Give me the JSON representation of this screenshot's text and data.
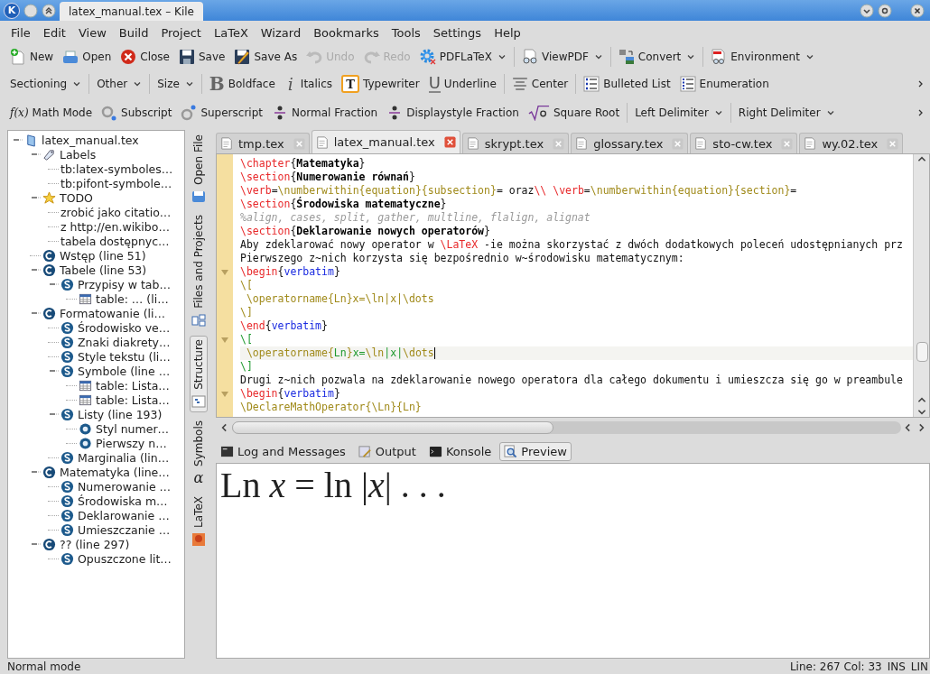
{
  "window": {
    "logo": "K",
    "title": "latex_manual.tex – Kile"
  },
  "menu": [
    "File",
    "Edit",
    "View",
    "Build",
    "Project",
    "LaTeX",
    "Wizard",
    "Bookmarks",
    "Tools",
    "Settings",
    "Help"
  ],
  "toolbars": [
    {
      "groups": [
        [
          {
            "label": "New",
            "dropdown": false,
            "disabled": false
          },
          {
            "label": "Open",
            "dropdown": false,
            "disabled": false
          },
          {
            "label": "Close",
            "dropdown": false,
            "disabled": false
          },
          {
            "label": "Save",
            "dropdown": false,
            "disabled": false
          },
          {
            "label": "Save As",
            "dropdown": false,
            "disabled": false
          },
          {
            "label": "Undo",
            "dropdown": false,
            "disabled": true
          },
          {
            "label": "Redo",
            "dropdown": false,
            "disabled": true
          },
          {
            "label": "PDFLaTeX",
            "dropdown": true,
            "disabled": false
          }
        ],
        [
          {
            "label": "ViewPDF",
            "dropdown": true,
            "disabled": false
          }
        ],
        [
          {
            "label": "Convert",
            "dropdown": true,
            "disabled": false
          }
        ],
        [
          {
            "label": "Environment",
            "dropdown": true,
            "disabled": false
          }
        ]
      ]
    },
    {
      "groups": [
        [
          {
            "label": "Sectioning",
            "dropdown": true
          }
        ],
        [
          {
            "label": "Other",
            "dropdown": true
          }
        ],
        [
          {
            "label": "Size",
            "dropdown": true
          }
        ],
        [
          {
            "label": "Boldface",
            "dropdown": false,
            "glyph": "B"
          },
          {
            "label": "Italics",
            "dropdown": false,
            "glyph": "i"
          },
          {
            "label": "Typewriter",
            "dropdown": false,
            "glyph": "T"
          },
          {
            "label": "Underline",
            "dropdown": false,
            "glyph": "U"
          }
        ],
        [
          {
            "label": "Center",
            "dropdown": false
          }
        ],
        [
          {
            "label": "Bulleted List",
            "dropdown": false
          },
          {
            "label": "Enumeration",
            "dropdown": false
          }
        ]
      ],
      "overflow": true
    },
    {
      "groups": [
        [
          {
            "label": "Math Mode",
            "dropdown": false,
            "glyph": "f(x)"
          },
          {
            "label": "Subscript",
            "dropdown": false
          },
          {
            "label": "Superscript",
            "dropdown": false
          },
          {
            "label": "Normal Fraction",
            "dropdown": false
          },
          {
            "label": "Displaystyle Fraction",
            "dropdown": false
          },
          {
            "label": "Square Root",
            "dropdown": false
          }
        ],
        [
          {
            "label": "Left Delimiter",
            "dropdown": true
          }
        ],
        [
          {
            "label": "Right Delimiter",
            "dropdown": true
          }
        ]
      ],
      "overflow": true
    }
  ],
  "structure": {
    "tree": {
      "label": "latex_manual.tex",
      "kind": "file",
      "expanded": true,
      "children": [
        {
          "label": "Labels",
          "kind": "labels",
          "expanded": true,
          "children": [
            {
              "label": "tb:latex-symboles…",
              "kind": "label"
            },
            {
              "label": "tb:pifont-symbole…",
              "kind": "label"
            }
          ]
        },
        {
          "label": "TODO",
          "kind": "todo",
          "expanded": true,
          "children": [
            {
              "label": "zrobić jako citatio…",
              "kind": "note"
            },
            {
              "label": "z http://en.wikibo…",
              "kind": "note"
            },
            {
              "label": "tabela dostępnyc…",
              "kind": "note"
            }
          ]
        },
        {
          "label": "Wstęp (line 51)",
          "kind": "chapter"
        },
        {
          "label": "Tabele (line 53)",
          "kind": "chapter",
          "expanded": true,
          "children": [
            {
              "label": "Przypisy w tab…",
              "kind": "section",
              "expanded": true,
              "children": [
                {
                  "label": "table: … (li…",
                  "kind": "table"
                }
              ]
            }
          ]
        },
        {
          "label": "Formatowanie (li…",
          "kind": "chapter",
          "expanded": true,
          "children": [
            {
              "label": "Środowisko ve…",
              "kind": "section"
            },
            {
              "label": "Znaki diakrety…",
              "kind": "section"
            },
            {
              "label": "Style tekstu (li…",
              "kind": "section"
            },
            {
              "label": "Symbole (line …",
              "kind": "section",
              "expanded": true,
              "children": [
                {
                  "label": "table: Lista…",
                  "kind": "table"
                },
                {
                  "label": "table: Lista…",
                  "kind": "table"
                }
              ]
            },
            {
              "label": "Listy (line 193)",
              "kind": "section",
              "expanded": true,
              "children": [
                {
                  "label": "Styl numer…",
                  "kind": "item"
                },
                {
                  "label": "Pierwszy n…",
                  "kind": "item"
                }
              ]
            },
            {
              "label": "Marginalia (lin…",
              "kind": "section"
            }
          ]
        },
        {
          "label": "Matematyka (line…",
          "kind": "chapter",
          "expanded": true,
          "children": [
            {
              "label": "Numerowanie …",
              "kind": "section"
            },
            {
              "label": "Środowiska m…",
              "kind": "section"
            },
            {
              "label": "Deklarowanie …",
              "kind": "section"
            },
            {
              "label": "Umieszczanie …",
              "kind": "section"
            }
          ]
        },
        {
          "label": "?? (line 297)",
          "kind": "chapter",
          "expanded": true,
          "children": [
            {
              "label": "Opuszczone lit…",
              "kind": "section"
            }
          ]
        }
      ]
    }
  },
  "side_tabs": [
    {
      "label": "Open File",
      "selected": false
    },
    {
      "label": "Files and Projects",
      "selected": false
    },
    {
      "label": "Structure",
      "selected": true
    },
    {
      "label": "Symbols",
      "selected": false,
      "glyph": "α"
    },
    {
      "label": "LaTeX",
      "selected": false
    }
  ],
  "editor": {
    "tabs": [
      {
        "label": "tmp.tex",
        "selected": false
      },
      {
        "label": "latex_manual.tex",
        "selected": true
      },
      {
        "label": "skrypt.tex",
        "selected": false
      },
      {
        "label": "glossary.tex",
        "selected": false
      },
      {
        "label": "sto-cw.tex",
        "selected": false
      },
      {
        "label": "wy.02.tex",
        "selected": false
      }
    ],
    "lines": [
      {
        "fold": false,
        "current": false,
        "segments": [
          {
            "t": "\\chapter",
            "kind": "cmd"
          },
          {
            "t": "{",
            "kind": "plain"
          },
          {
            "t": "Matematyka",
            "kind": "bold"
          },
          {
            "t": "}",
            "kind": "plain"
          }
        ]
      },
      {
        "fold": false,
        "current": false,
        "segments": [
          {
            "t": "\\section",
            "kind": "cmd"
          },
          {
            "t": "{",
            "kind": "plain"
          },
          {
            "t": "Numerowanie równań",
            "kind": "bold"
          },
          {
            "t": "}",
            "kind": "plain"
          }
        ]
      },
      {
        "fold": false,
        "current": false,
        "segments": [
          {
            "t": "\\verb",
            "kind": "cmd"
          },
          {
            "t": "=",
            "kind": "plain"
          },
          {
            "t": "\\numberwithin{equation}{subsection}",
            "kind": "math"
          },
          {
            "t": "= oraz",
            "kind": "plain"
          },
          {
            "t": "\\\\ ",
            "kind": "cmd"
          },
          {
            "t": "\\verb",
            "kind": "cmd"
          },
          {
            "t": "=",
            "kind": "plain"
          },
          {
            "t": "\\numberwithin{equation}{section}",
            "kind": "math"
          },
          {
            "t": "=",
            "kind": "plain"
          }
        ]
      },
      {
        "fold": false,
        "current": false,
        "segments": [
          {
            "t": "\\section",
            "kind": "cmd"
          },
          {
            "t": "{",
            "kind": "plain"
          },
          {
            "t": "Środowiska matematyczne",
            "kind": "bold"
          },
          {
            "t": "}",
            "kind": "plain"
          }
        ]
      },
      {
        "fold": false,
        "current": false,
        "segments": [
          {
            "t": "%align, cases, split, gather, multline, flalign, alignat",
            "kind": "comment"
          }
        ]
      },
      {
        "fold": false,
        "current": false,
        "segments": [
          {
            "t": "\\section",
            "kind": "cmd"
          },
          {
            "t": "{",
            "kind": "plain"
          },
          {
            "t": "Deklarowanie nowych operatorów",
            "kind": "bold"
          },
          {
            "t": "}",
            "kind": "plain"
          }
        ]
      },
      {
        "fold": false,
        "current": false,
        "segments": [
          {
            "t": "Aby zdeklarować nowy operator w ",
            "kind": "plain"
          },
          {
            "t": "\\LaTeX",
            "kind": "cmd"
          },
          {
            "t": " -ie można skorzystać z dwóch dodatkowych poleceń udostępnianych prz",
            "kind": "plain"
          }
        ]
      },
      {
        "fold": false,
        "current": false,
        "segments": [
          {
            "t": "Pierwszego z~nich korzysta się bezpośrednio w~środowisku matematycznym:",
            "kind": "plain"
          }
        ]
      },
      {
        "fold": true,
        "current": false,
        "segments": [
          {
            "t": "\\begin",
            "kind": "cmd"
          },
          {
            "t": "{",
            "kind": "plain"
          },
          {
            "t": "verbatim",
            "kind": "env"
          },
          {
            "t": "}",
            "kind": "plain"
          }
        ]
      },
      {
        "fold": false,
        "current": false,
        "segments": [
          {
            "t": "\\[",
            "kind": "math"
          }
        ]
      },
      {
        "fold": false,
        "current": false,
        "segments": [
          {
            "t": " \\operatorname{Ln}x=\\ln|x|\\dots",
            "kind": "math"
          }
        ]
      },
      {
        "fold": false,
        "current": false,
        "segments": [
          {
            "t": "\\]",
            "kind": "math"
          }
        ]
      },
      {
        "fold": false,
        "current": false,
        "segments": [
          {
            "t": "\\end",
            "kind": "cmd"
          },
          {
            "t": "{",
            "kind": "plain"
          },
          {
            "t": "verbatim",
            "kind": "env"
          },
          {
            "t": "}",
            "kind": "plain"
          }
        ]
      },
      {
        "fold": true,
        "current": false,
        "segments": [
          {
            "t": "\\[",
            "kind": "green"
          }
        ]
      },
      {
        "fold": false,
        "current": true,
        "segments": [
          {
            "t": " \\operatorname{",
            "kind": "math"
          },
          {
            "t": "Ln",
            "kind": "green"
          },
          {
            "t": "}",
            "kind": "math"
          },
          {
            "t": "x=",
            "kind": "green"
          },
          {
            "t": "\\ln",
            "kind": "math"
          },
          {
            "t": "|x|",
            "kind": "green"
          },
          {
            "t": "\\dots",
            "kind": "math"
          }
        ]
      },
      {
        "fold": false,
        "current": false,
        "segments": [
          {
            "t": "\\]",
            "kind": "green"
          }
        ]
      },
      {
        "fold": false,
        "current": false,
        "segments": [
          {
            "t": "Drugi z~nich pozwala na zdeklarowanie nowego operatora dla całego dokumentu i umieszcza się go w preambule",
            "kind": "plain"
          }
        ]
      },
      {
        "fold": true,
        "current": false,
        "segments": [
          {
            "t": "\\begin",
            "kind": "cmd"
          },
          {
            "t": "{",
            "kind": "plain"
          },
          {
            "t": "verbatim",
            "kind": "env"
          },
          {
            "t": "}",
            "kind": "plain"
          }
        ]
      },
      {
        "fold": false,
        "current": false,
        "segments": [
          {
            "t": "\\DeclareMathOperator{\\Ln}{Ln}",
            "kind": "math"
          }
        ]
      }
    ]
  },
  "bottom_tabs": [
    {
      "label": "Log and Messages",
      "selected": false
    },
    {
      "label": "Output",
      "selected": false
    },
    {
      "label": "Konsole",
      "selected": false
    },
    {
      "label": "Preview",
      "selected": true
    }
  ],
  "preview": {
    "formula": "Ln *x* = ln |*x*| . . ."
  },
  "status_bar": {
    "mode": "Normal mode",
    "position": "Line: 267 Col: 33",
    "insert": "INS",
    "selection": "LIN"
  }
}
